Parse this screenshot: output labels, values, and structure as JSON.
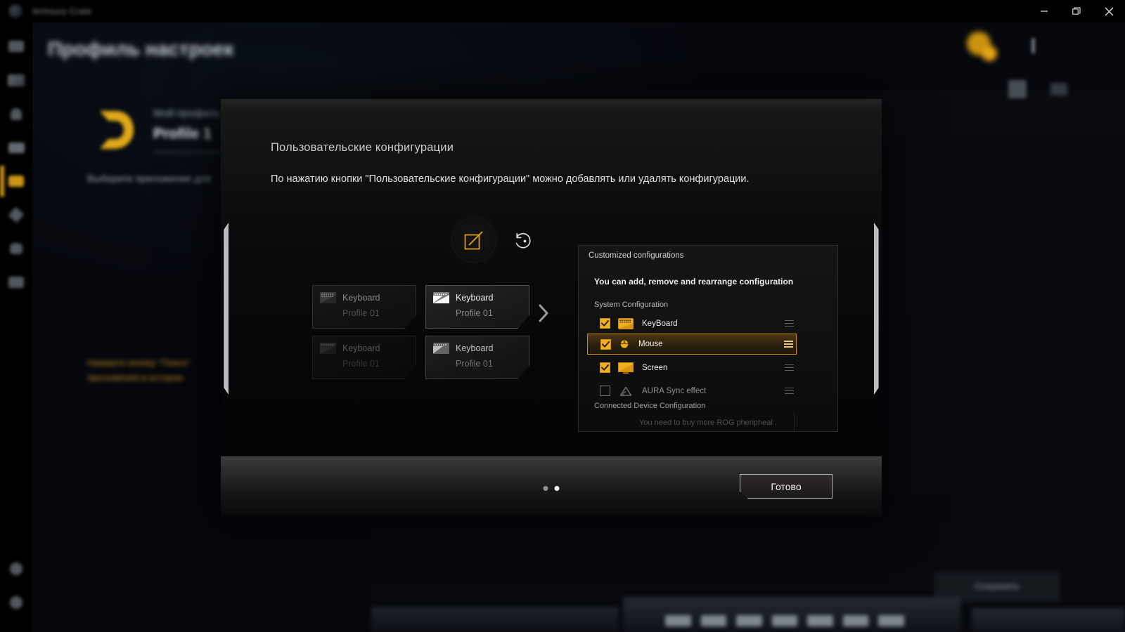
{
  "titlebar": {
    "app_title": "Armoury Crate",
    "logo_icon": "app-logo-icon",
    "minimize_label": "—",
    "restore_label": "❐",
    "close_label": "✕"
  },
  "sidebar": {
    "items": [
      {
        "icon": "home-icon",
        "label": ""
      },
      {
        "icon": "device-icon",
        "label": ""
      },
      {
        "icon": "aura-icon",
        "label": ""
      },
      {
        "icon": "scenario-icon",
        "label": ""
      },
      {
        "icon": "profile-settings-icon",
        "label": "",
        "active": true
      },
      {
        "icon": "tools-icon",
        "label": ""
      },
      {
        "icon": "game-library-icon",
        "label": ""
      },
      {
        "icon": "news-icon",
        "label": ""
      }
    ],
    "bottom_items": [
      {
        "icon": "user-account-icon",
        "label": ""
      },
      {
        "icon": "settings-icon",
        "label": ""
      }
    ]
  },
  "background": {
    "page_title": "Профиль настроек",
    "profile_logo_icon": "rog-d-logo-icon",
    "profile_caption": "Мой профиль",
    "profile_name": "Profile 1",
    "subtitle": "Выберите приложение для",
    "orange_note_line1": "Нажмите кнопку \"Поиск\"",
    "orange_note_line2": "приложения в истории",
    "avatar_icon": "user-avatar-icon",
    "kebab_icon": "more-vertical-icon",
    "action_icon_a": "add-icon",
    "action_icon_b": "edit-icon",
    "bottom_button_label": "Сохранить"
  },
  "modal": {
    "title": "Пользовательские конфигурации",
    "description": "По нажатию кнопки \"Пользовательские конфигурации\" можно добавлять или удалять конфигурации.",
    "edit_icon": "edit-square-icon",
    "reset_icon": "reset-circular-arrow-icon",
    "left_bracket_icon": "panel-handle-left-icon",
    "right_bracket_icon": "panel-handle-right-icon",
    "next_arrow_icon": "chevron-right-icon",
    "accent_color": "#e8a317",
    "cards": [
      {
        "icon": "keyboard-icon",
        "name": "Keyboard",
        "profile": "Profile 01"
      },
      {
        "icon": "keyboard-icon",
        "name": "Keyboard",
        "profile": "Profile 01"
      },
      {
        "icon": "keyboard-icon",
        "name": "Keyboard",
        "profile": "Profile 01"
      },
      {
        "icon": "keyboard-icon",
        "name": "Keyboard",
        "profile": "Profile 01"
      }
    ],
    "popup": {
      "title": "Customized configurations",
      "subtitle": "You can add, remove and rearrange configuration",
      "section_system": "System Configuration",
      "rows": [
        {
          "label": "KeyBoard",
          "icon": "keyboard-icon",
          "checked": true,
          "selected": false,
          "drag_icon": "drag-handle-icon"
        },
        {
          "label": "Mouse",
          "icon": "mouse-icon",
          "checked": true,
          "selected": true,
          "drag_icon": "drag-handle-icon"
        },
        {
          "label": "Screen",
          "icon": "screen-icon",
          "checked": true,
          "selected": false,
          "drag_icon": "drag-handle-icon"
        },
        {
          "label": "AURA Sync effect",
          "icon": "aura-icon",
          "checked": false,
          "selected": false,
          "drag_icon": "drag-handle-icon"
        }
      ],
      "section_connected": "Connected Device Configuration",
      "empty_note": "You need to buy more ROG pheripheal ."
    },
    "footer": {
      "dots": [
        {
          "active": false
        },
        {
          "active": true
        }
      ],
      "done_label": "Готово"
    }
  }
}
